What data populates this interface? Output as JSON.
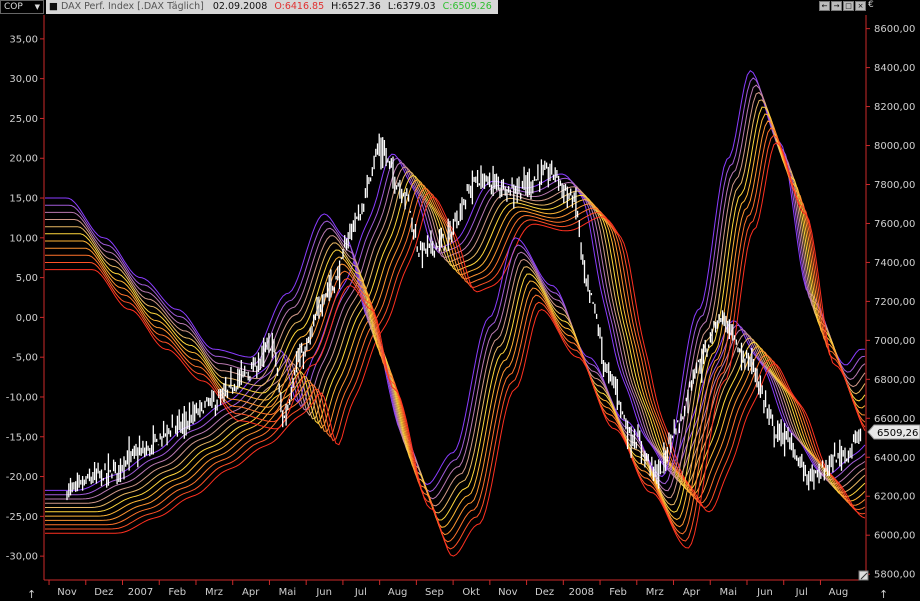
{
  "toolbar": {
    "symbol_selector": "COP",
    "info": {
      "instrument": "DAX Perf. Index [.DAX Täglich]",
      "date": "02.09.2008",
      "open": "O:6416.85",
      "high": "H:6527.36",
      "low": "L:6379.03",
      "close": "C:6509.26"
    },
    "currency": "€",
    "window_buttons": [
      "←",
      "→",
      "□",
      "×"
    ]
  },
  "colors": {
    "background": "#000000",
    "price_bars": "#ffffff",
    "frame_red": "#cc2a2a",
    "close_green": "#2fbf2f",
    "open_red": "#e03030",
    "ribbon_start": "#8a3cff",
    "ribbon_end": "#ff3020"
  },
  "price_tag": "6509,26",
  "chart_data": {
    "type": "line",
    "x_labels": [
      "Nov",
      "Dez",
      "2007",
      "Feb",
      "Mrz",
      "Apr",
      "Mai",
      "Jun",
      "Jul",
      "Aug",
      "Sep",
      "Okt",
      "Nov",
      "Dez",
      "2008",
      "Feb",
      "Mrz",
      "Apr",
      "Mai",
      "Jun",
      "Jul",
      "Aug"
    ],
    "left_axis": {
      "ticks": [
        "35,00",
        "30,00",
        "25,00",
        "20,00",
        "15,00",
        "10,00",
        "5,00",
        "0,00",
        "-5,00",
        "-10,00",
        "-15,00",
        "-20,00",
        "-25,00",
        "-30,00"
      ],
      "range": [
        -33,
        38
      ]
    },
    "right_axis": {
      "ticks": [
        "8600,00",
        "8400,00",
        "8200,00",
        "8000,00",
        "7800,00",
        "7600,00",
        "7400,00",
        "7200,00",
        "7000,00",
        "6800,00",
        "6600,00",
        "6400,00",
        "6200,00",
        "6000,00",
        "5800,00"
      ],
      "range": [
        5770,
        8670
      ]
    },
    "price_close_path": [
      [
        0,
        6230
      ],
      [
        1,
        6310
      ],
      [
        2,
        6420
      ],
      [
        3,
        6560
      ],
      [
        4,
        6680
      ],
      [
        5,
        6840
      ],
      [
        5.6,
        6980
      ],
      [
        5.9,
        6600
      ],
      [
        6.3,
        6900
      ],
      [
        7.2,
        7280
      ],
      [
        7.9,
        7620
      ],
      [
        8.5,
        7980
      ],
      [
        9.2,
        7760
      ],
      [
        9.6,
        7460
      ],
      [
        10.2,
        7500
      ],
      [
        11.2,
        7820
      ],
      [
        12.2,
        7780
      ],
      [
        13.2,
        7860
      ],
      [
        13.8,
        7720
      ],
      [
        14.2,
        7240
      ],
      [
        14.8,
        6800
      ],
      [
        15.4,
        6500
      ],
      [
        16.1,
        6320
      ],
      [
        16.6,
        6560
      ],
      [
        17.2,
        6880
      ],
      [
        17.8,
        7120
      ],
      [
        18.5,
        6900
      ],
      [
        19.4,
        6520
      ],
      [
        20.3,
        6300
      ],
      [
        21.2,
        6420
      ],
      [
        21.6,
        6509
      ]
    ],
    "upper_ribbon_left_axis_path": [
      [
        0,
        15
      ],
      [
        1,
        10
      ],
      [
        2,
        5
      ],
      [
        3,
        1
      ],
      [
        4,
        -4
      ],
      [
        5,
        -5
      ],
      [
        6,
        3
      ],
      [
        7,
        13
      ],
      [
        7.6,
        10
      ],
      [
        8.2,
        0
      ],
      [
        9.2,
        -15
      ],
      [
        9.8,
        -21
      ],
      [
        10.5,
        -17
      ],
      [
        11.5,
        0
      ],
      [
        12.2,
        10
      ],
      [
        13.2,
        4
      ],
      [
        14.2,
        -5
      ],
      [
        15.2,
        -13
      ],
      [
        16.2,
        -20
      ],
      [
        17.2,
        1
      ],
      [
        18,
        20
      ],
      [
        18.6,
        31
      ],
      [
        19.4,
        22
      ],
      [
        20.2,
        3
      ],
      [
        21.2,
        -6
      ],
      [
        21.6,
        -4
      ]
    ]
  }
}
